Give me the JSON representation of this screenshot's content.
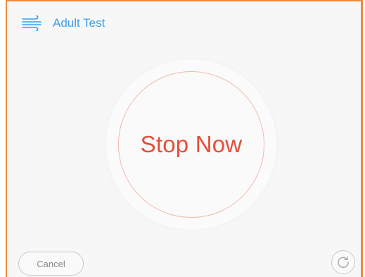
{
  "header": {
    "icon": "wind-icon",
    "title": "Adult Test"
  },
  "main": {
    "stop_label": "Stop Now"
  },
  "footer": {
    "cancel_label": "Cancel",
    "refresh_icon": "refresh-icon"
  },
  "colors": {
    "accent_border": "#f08a3c",
    "title_blue": "#3d9de8",
    "stop_red": "#e2503b"
  }
}
